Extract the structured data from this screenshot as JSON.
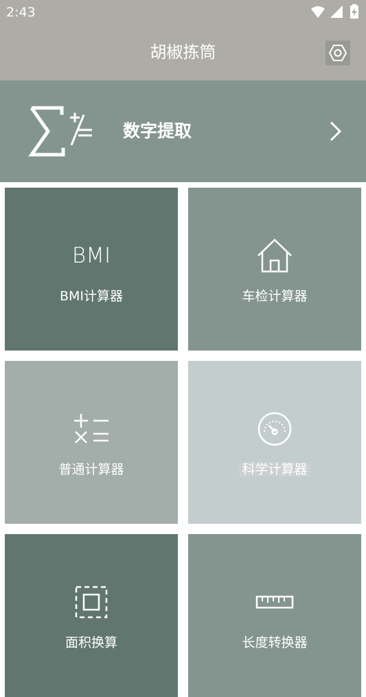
{
  "status_bar": {
    "time": "2:43",
    "icons": [
      "wifi-icon",
      "signal-icon",
      "battery-charging-icon"
    ]
  },
  "header": {
    "title": "胡椒拣筒",
    "settings_icon": "hexagon-settings-icon",
    "background": "#adaca6"
  },
  "banner": {
    "label": "数字提取",
    "icon": "sigma-plus-divide-icon",
    "chevron_icon": "chevron-right-icon",
    "background": "#84958f"
  },
  "tiles": [
    {
      "label": "BMI计算器",
      "icon_text": "BMI",
      "icon": "bmi-text-icon",
      "background": "#627670"
    },
    {
      "label": "车检计算器",
      "icon": "house-icon",
      "background": "#84958f"
    },
    {
      "label": "普通计算器",
      "icon": "arithmetic-operators-icon",
      "background": "#a3adaa"
    },
    {
      "label": "科学计算器",
      "icon": "speedometer-icon",
      "background": "#c4cdcd"
    },
    {
      "label": "面积换算",
      "icon": "area-frame-icon",
      "background": "#627670"
    },
    {
      "label": "长度转换器",
      "icon": "ruler-icon",
      "background": "#84958f"
    }
  ]
}
